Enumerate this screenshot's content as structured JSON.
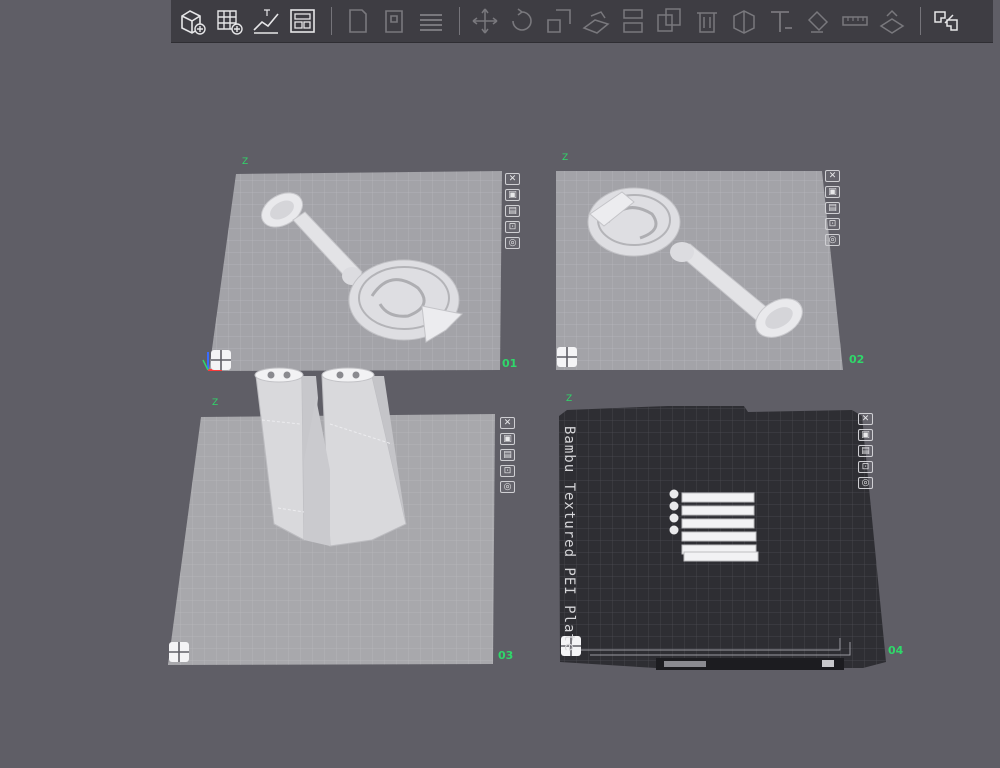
{
  "toolbar": {
    "buttons": [
      {
        "name": "add-cube-icon",
        "enabled": true
      },
      {
        "name": "add-plate-icon",
        "enabled": true
      },
      {
        "name": "auto-orient-icon",
        "enabled": true
      },
      {
        "name": "arrange-icon",
        "enabled": true
      },
      {
        "name": "copy-icon",
        "enabled": false
      },
      {
        "name": "paste-icon",
        "enabled": false
      },
      {
        "name": "layers-icon",
        "enabled": false
      },
      {
        "name": "move-icon",
        "enabled": false
      },
      {
        "name": "rotate-icon",
        "enabled": false
      },
      {
        "name": "scale-icon",
        "enabled": false
      },
      {
        "name": "lay-on-face-icon",
        "enabled": false
      },
      {
        "name": "cut-icon",
        "enabled": false
      },
      {
        "name": "boolean-icon",
        "enabled": false
      },
      {
        "name": "support-paint-icon",
        "enabled": false
      },
      {
        "name": "seam-paint-icon",
        "enabled": false
      },
      {
        "name": "text-icon",
        "enabled": false
      },
      {
        "name": "color-paint-icon",
        "enabled": false
      },
      {
        "name": "measure-icon",
        "enabled": false
      },
      {
        "name": "assembly-icon",
        "enabled": false
      },
      {
        "name": "split-icon",
        "enabled": true
      }
    ]
  },
  "plates": [
    {
      "number": "01",
      "axis": "Z"
    },
    {
      "number": "02",
      "axis": "Z"
    },
    {
      "number": "03",
      "axis": "Z"
    },
    {
      "number": "04",
      "axis": "Z",
      "label": "Bambu Textured PEI Plate"
    }
  ],
  "plate_tools": [
    "close-icon",
    "pick-icon",
    "arrange-icon",
    "lock-icon",
    "settings-icon"
  ],
  "colors": {
    "background": "#5f5e66",
    "toolbar": "#3e3d43",
    "plate_surface": "#a6a6aa",
    "pei_surface": "#2e2e33",
    "plate_number": "#2fd86a"
  }
}
